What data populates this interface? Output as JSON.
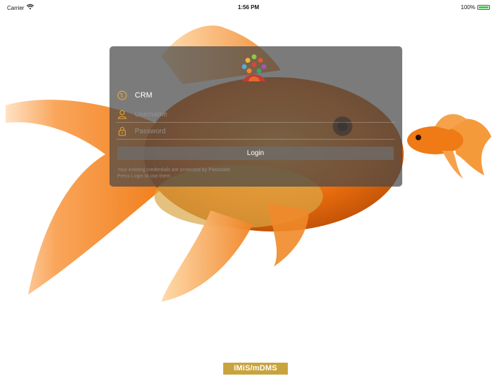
{
  "status_bar": {
    "carrier": "Carrier",
    "time": "1:56 PM",
    "battery": "100%",
    "icons": [
      "wifi-icon",
      "battery-icon"
    ],
    "battery_level": 1.0
  },
  "login": {
    "server_name": "CRM",
    "username_placeholder": "Username",
    "password_placeholder": "Password",
    "login_label": "Login",
    "hint_line1": "Your existing credentials are protected by Passcode.",
    "hint_line2": "Press Login to use them."
  },
  "brand": {
    "text": "IMiS/mDMS"
  },
  "colors": {
    "accent": "#e8a534",
    "panel": "#484848",
    "brand_bg": "#c8a33e",
    "fish_orange": "#f07a14"
  },
  "icons": [
    "logo-people-icon",
    "globe-icon",
    "user-icon",
    "lock-icon"
  ]
}
